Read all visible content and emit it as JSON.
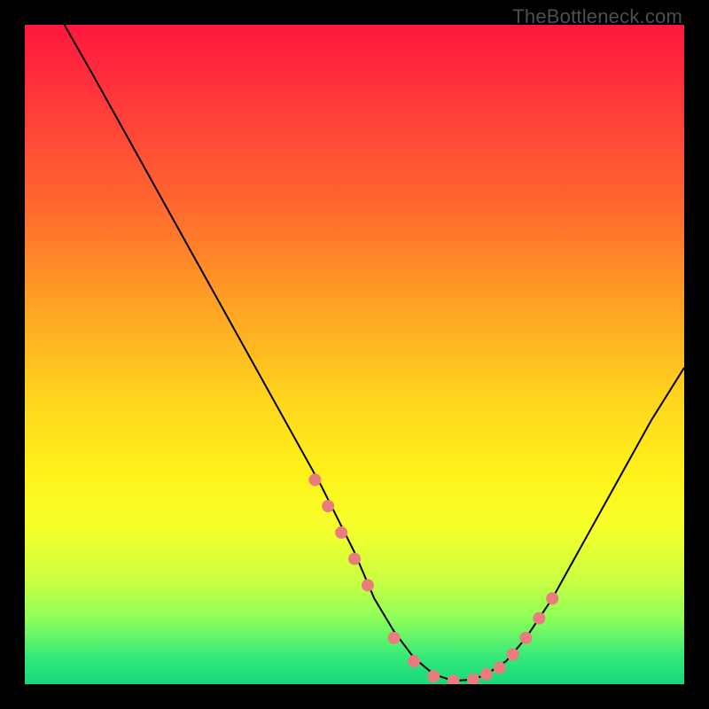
{
  "watermark": "TheBottleneck.com",
  "chart_data": {
    "type": "line",
    "title": "",
    "xlabel": "",
    "ylabel": "",
    "xlim": [
      0,
      100
    ],
    "ylim": [
      0,
      100
    ],
    "grid": false,
    "legend": false,
    "series": [
      {
        "name": "curve",
        "x": [
          6,
          10,
          15,
          20,
          25,
          30,
          35,
          40,
          45,
          48,
          50,
          53,
          56,
          59,
          62,
          65,
          68,
          70,
          73,
          76,
          80,
          85,
          90,
          95,
          100
        ],
        "y": [
          100,
          93,
          84,
          75,
          66,
          57,
          48,
          39,
          30,
          24,
          20,
          13,
          8,
          4,
          1.5,
          0.5,
          0.7,
          1.5,
          3.5,
          7,
          13,
          22,
          31,
          40,
          48
        ],
        "stroke": "#000000",
        "stroke_width": 2
      }
    ],
    "markers": {
      "name": "highlight-dots",
      "color": "#e97c7c",
      "radius": 7,
      "x": [
        44,
        46,
        48,
        50,
        52,
        56,
        59,
        62,
        65,
        68,
        70,
        72,
        74,
        76,
        78,
        80
      ],
      "y": [
        31,
        27,
        23,
        19,
        15,
        7,
        3.5,
        1.2,
        0.5,
        0.7,
        1.5,
        2.5,
        4.5,
        7,
        10,
        13
      ]
    }
  }
}
